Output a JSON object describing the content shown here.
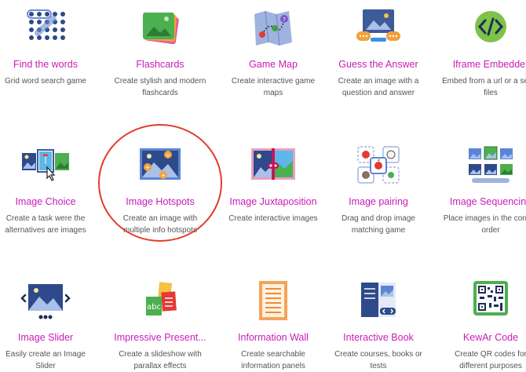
{
  "cards": [
    {
      "title": "Find the words",
      "desc": "Grid word search game",
      "icon": "grid-dots-icon"
    },
    {
      "title": "Flashcards",
      "desc": "Create stylish and modern flashcards",
      "icon": "flashcards-icon"
    },
    {
      "title": "Game Map",
      "desc": "Create interactive game maps",
      "icon": "game-map-icon"
    },
    {
      "title": "Guess the Answer",
      "desc": "Create an image with a question and answer",
      "icon": "guess-answer-icon"
    },
    {
      "title": "Iframe Embedder",
      "desc": "Embed from a url or a set of files",
      "icon": "code-embed-icon"
    },
    {
      "title": "Image Choice",
      "desc": "Create a task were the alternatives are images",
      "icon": "image-choice-icon"
    },
    {
      "title": "Image Hotspots",
      "desc": "Create an image with multiple info hotspots",
      "icon": "image-hotspots-icon"
    },
    {
      "title": "Image Juxtaposition",
      "desc": "Create interactive images",
      "icon": "image-juxtaposition-icon"
    },
    {
      "title": "Image pairing",
      "desc": "Drag and drop image matching game",
      "icon": "image-pairing-icon"
    },
    {
      "title": "Image Sequencing",
      "desc": "Place images in the correct order",
      "icon": "image-sequencing-icon"
    },
    {
      "title": "Image Slider",
      "desc": "Easily create an Image Slider",
      "icon": "image-slider-icon"
    },
    {
      "title": "Impressive Present...",
      "desc": "Create a slideshow with parallax effects",
      "icon": "impressive-presentation-icon"
    },
    {
      "title": "Information Wall",
      "desc": "Create searchable information panels",
      "icon": "information-wall-icon"
    },
    {
      "title": "Interactive Book",
      "desc": "Create courses, books or tests",
      "icon": "interactive-book-icon"
    },
    {
      "title": "KewAr Code",
      "desc": "Create QR codes for different purposes",
      "icon": "qr-code-icon"
    }
  ]
}
